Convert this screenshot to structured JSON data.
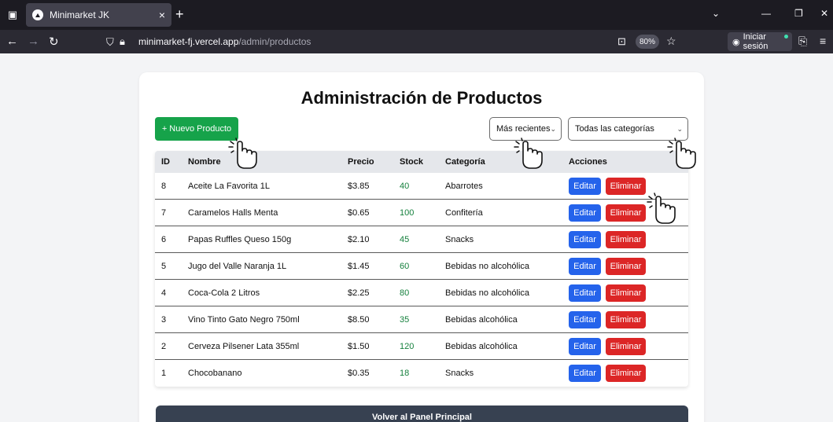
{
  "browser": {
    "tab_title": "Minimarket JK",
    "url_host": "minimarket-fj.vercel.app",
    "url_path": "/admin/productos",
    "zoom": "80%",
    "signin_label": "Iniciar sesión"
  },
  "page": {
    "title": "Administración de Productos",
    "new_product_label": "+ Nuevo Producto",
    "sort_value": "Más recientes",
    "category_value": "Todas las categorías",
    "back_label": "Volver al Panel Principal"
  },
  "table": {
    "headers": [
      "ID",
      "Nombre",
      "Precio",
      "Stock",
      "Categoría",
      "Acciones"
    ],
    "edit_label": "Editar",
    "delete_label": "Eliminar",
    "rows": [
      {
        "id": "8",
        "name": "Aceite La Favorita 1L",
        "price": "$3.85",
        "stock": "40",
        "category": "Abarrotes"
      },
      {
        "id": "7",
        "name": "Caramelos Halls Menta",
        "price": "$0.65",
        "stock": "100",
        "category": "Confitería"
      },
      {
        "id": "6",
        "name": "Papas Ruffles Queso 150g",
        "price": "$2.10",
        "stock": "45",
        "category": "Snacks"
      },
      {
        "id": "5",
        "name": "Jugo del Valle Naranja 1L",
        "price": "$1.45",
        "stock": "60",
        "category": "Bebidas no alcohólica"
      },
      {
        "id": "4",
        "name": "Coca-Cola 2 Litros",
        "price": "$2.25",
        "stock": "80",
        "category": "Bebidas no alcohólica"
      },
      {
        "id": "3",
        "name": "Vino Tinto Gato Negro 750ml",
        "price": "$8.50",
        "stock": "35",
        "category": "Bebidas alcohólica"
      },
      {
        "id": "2",
        "name": "Cerveza Pilsener Lata 355ml",
        "price": "$1.50",
        "stock": "120",
        "category": "Bebidas alcohólica"
      },
      {
        "id": "1",
        "name": "Chocobanano",
        "price": "$0.35",
        "stock": "18",
        "category": "Snacks"
      }
    ]
  },
  "colors": {
    "primary_green": "#16a34a",
    "edit_blue": "#2563eb",
    "delete_red": "#dc2626",
    "stock_green": "#15803d",
    "footer_slate": "#374151"
  }
}
